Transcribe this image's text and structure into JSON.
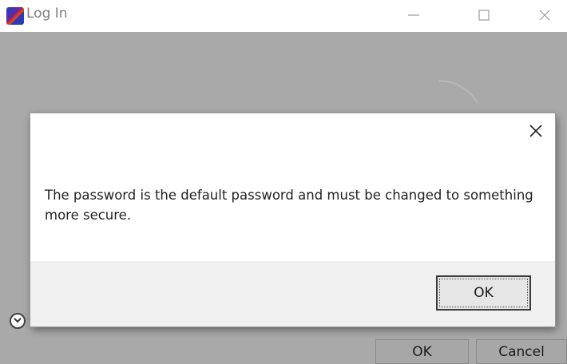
{
  "window": {
    "title": "Log In",
    "controls": {
      "minimize": "—",
      "maximize": "☐",
      "close": "✕"
    }
  },
  "background": {
    "ok_label": "OK",
    "cancel_label": "Cancel"
  },
  "dialog": {
    "message": "The password is the default password and must be changed to something more secure.",
    "ok_label": "OK"
  },
  "icons": {
    "app": "app-icon",
    "close": "close-icon",
    "chevron": "chevron-down-icon"
  }
}
